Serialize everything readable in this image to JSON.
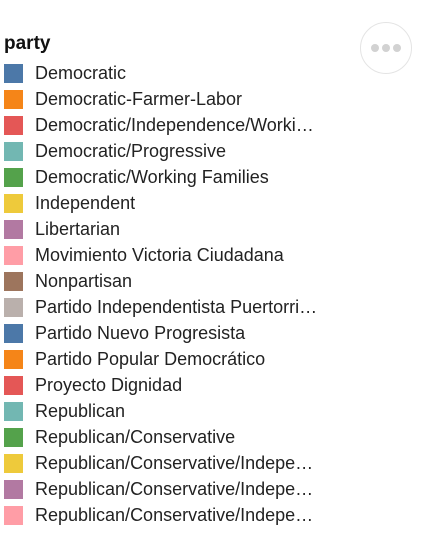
{
  "legend": {
    "title": "party",
    "items": [
      {
        "label": "Democratic",
        "color": "#4c78a8"
      },
      {
        "label": "Democratic-Farmer-Labor",
        "color": "#f58518"
      },
      {
        "label": "Democratic/Independence/Worki…",
        "color": "#e45756"
      },
      {
        "label": "Democratic/Progressive",
        "color": "#72b7b2"
      },
      {
        "label": "Democratic/Working Families",
        "color": "#54a24b"
      },
      {
        "label": "Independent",
        "color": "#eeca3b"
      },
      {
        "label": "Libertarian",
        "color": "#b279a2"
      },
      {
        "label": "Movimiento Victoria Ciudadana",
        "color": "#ff9da6"
      },
      {
        "label": "Nonpartisan",
        "color": "#9d755d"
      },
      {
        "label": "Partido Independentista Puertorri…",
        "color": "#bab0ac"
      },
      {
        "label": "Partido Nuevo Progresista",
        "color": "#4c78a8"
      },
      {
        "label": "Partido Popular Democrático",
        "color": "#f58518"
      },
      {
        "label": "Proyecto Dignidad",
        "color": "#e45756"
      },
      {
        "label": "Republican",
        "color": "#72b7b2"
      },
      {
        "label": "Republican/Conservative",
        "color": "#54a24b"
      },
      {
        "label": "Republican/Conservative/Indepe…",
        "color": "#eeca3b"
      },
      {
        "label": "Republican/Conservative/Indepe…",
        "color": "#b279a2"
      },
      {
        "label": "Republican/Conservative/Indepe…",
        "color": "#ff9da6"
      }
    ]
  },
  "actions_menu": {
    "icon": "more-horizontal-icon",
    "color": "#d2d2d2"
  }
}
